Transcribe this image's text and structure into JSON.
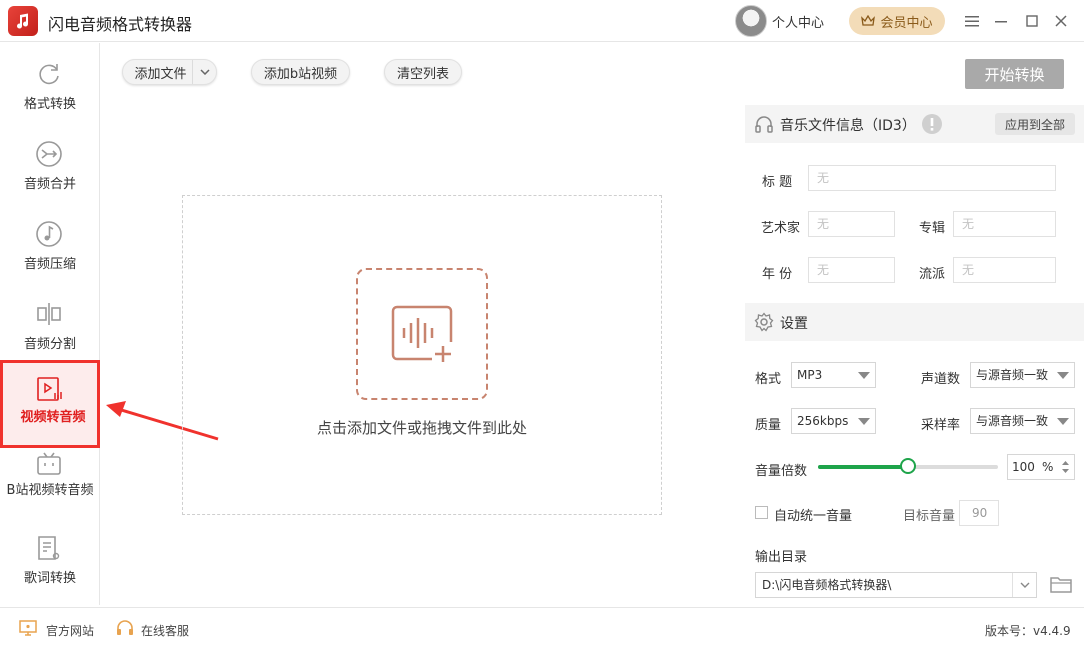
{
  "window": {
    "title": "闪电音频格式转换器",
    "user_center": "个人中心",
    "vip_label": "会员中心"
  },
  "sidebar": {
    "items": [
      {
        "label": "格式转换",
        "icon": "refresh-icon"
      },
      {
        "label": "音频合并",
        "icon": "merge-icon"
      },
      {
        "label": "音频压缩",
        "icon": "compress-icon"
      },
      {
        "label": "音频分割",
        "icon": "split-icon"
      },
      {
        "label": "视频转音频",
        "icon": "video-audio-icon"
      },
      {
        "label": "B站视频转音频",
        "icon": "bilibili-icon"
      },
      {
        "label": "歌词转换",
        "icon": "lyrics-icon"
      }
    ]
  },
  "toolbar": {
    "add_file": "添加文件",
    "add_bilibili": "添加b站视频",
    "clear_list": "清空列表",
    "start": "开始转换"
  },
  "dropzone": {
    "hint": "点击添加文件或拖拽文件到此处"
  },
  "id3": {
    "title": "音乐文件信息（ID3）",
    "apply_all": "应用到全部",
    "fields": {
      "title_label": "标  题",
      "artist_label": "艺术家",
      "album_label": "专辑",
      "year_label": "年  份",
      "genre_label": "流派",
      "placeholder": "无"
    }
  },
  "settings": {
    "title": "设置",
    "format_label": "格式",
    "format_value": "MP3",
    "channels_label": "声道数",
    "channels_value": "与源音频一致",
    "quality_label": "质量",
    "quality_value": "256kbps",
    "sample_rate_label": "采样率",
    "sample_rate_value": "与源音频一致",
    "volume_label": "音量倍数",
    "volume_value": "100",
    "volume_unit": "%",
    "volume_level": 0.5,
    "auto_volume_label": "自动统一音量",
    "target_volume_label": "目标音量",
    "target_volume_value": "90",
    "output_dir_label": "输出目录",
    "output_dir_value": "D:\\闪电音频格式转换器\\"
  },
  "footer": {
    "website": "官方网站",
    "support": "在线客服",
    "version": "版本号：v4.4.9"
  },
  "colors": {
    "accent_red": "#f0322d",
    "slider_green": "#1ea44a",
    "vip_gold": "#f3dcb8"
  }
}
